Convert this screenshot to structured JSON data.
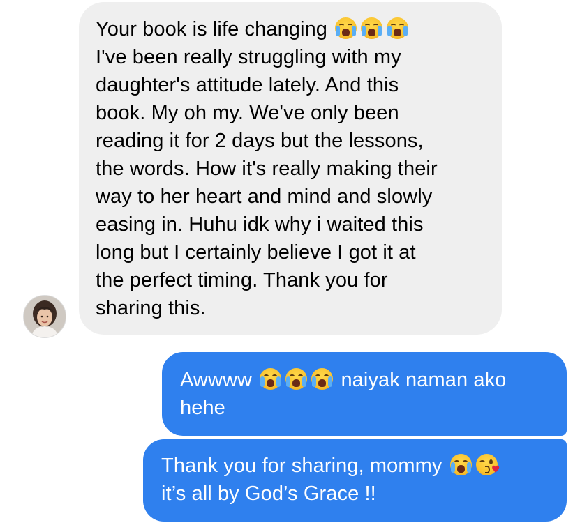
{
  "conversation": {
    "incoming_message": {
      "lines": [
        "Your book is life changing",
        "I've been really struggling with my",
        "daughter's attitude lately. And this",
        "book. My oh my. We've only been",
        "reading it for 2 days but the lessons,",
        "the words. How it's really making their",
        "way to her heart and mind and slowly",
        "easing in. Huhu idk why i waited this",
        "long but I certainly believe I got it at",
        "the perfect timing. Thank you for",
        "sharing this."
      ],
      "emoji": [
        "crying-face",
        "crying-face",
        "crying-face"
      ]
    },
    "outgoing_message_1": {
      "before_emoji": "Awwww",
      "after_emoji": "naiyak naman ako",
      "line2": "hehe",
      "emoji": [
        "crying-face",
        "crying-face",
        "crying-face"
      ]
    },
    "outgoing_message_2": {
      "line1": "Thank you for sharing, mommy",
      "line2": "it’s all by God’s Grace !!",
      "emoji": [
        "crying-face",
        "face-blowing-kiss"
      ]
    }
  },
  "colors": {
    "incoming_bubble": "#efefef",
    "outgoing_bubble": "#2f80ee",
    "incoming_text": "#000000",
    "outgoing_text": "#ffffff"
  }
}
